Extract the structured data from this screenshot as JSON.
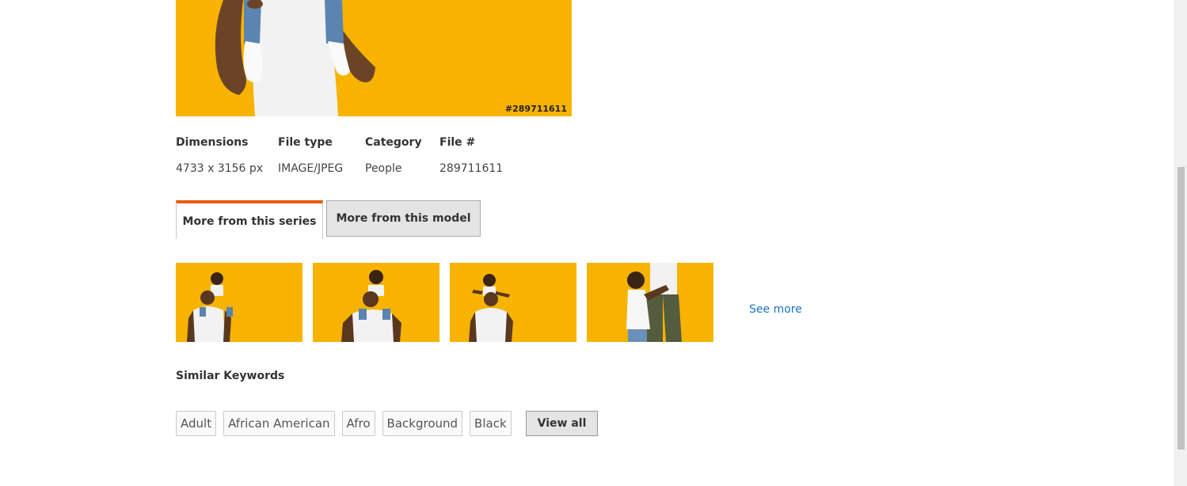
{
  "main_image": {
    "id_label": "#289711611"
  },
  "details": [
    {
      "label": "Dimensions",
      "value": "4733 x 3156 px"
    },
    {
      "label": "File type",
      "value": "IMAGE/JPEG"
    },
    {
      "label": "Category",
      "value": "People"
    },
    {
      "label": "File #",
      "value": "289711611"
    }
  ],
  "tabs": [
    {
      "label": "More from this series",
      "active": true
    },
    {
      "label": "More from this model",
      "active": false
    }
  ],
  "see_more": "See more",
  "keywords": {
    "title": "Similar Keywords",
    "items": [
      "Adult",
      "African American",
      "Afro",
      "Background",
      "Black"
    ],
    "view_all": "View all"
  },
  "colors": {
    "photo_background": "#f7b300",
    "tab_accent": "#e95c12",
    "link": "#1a73c5"
  }
}
